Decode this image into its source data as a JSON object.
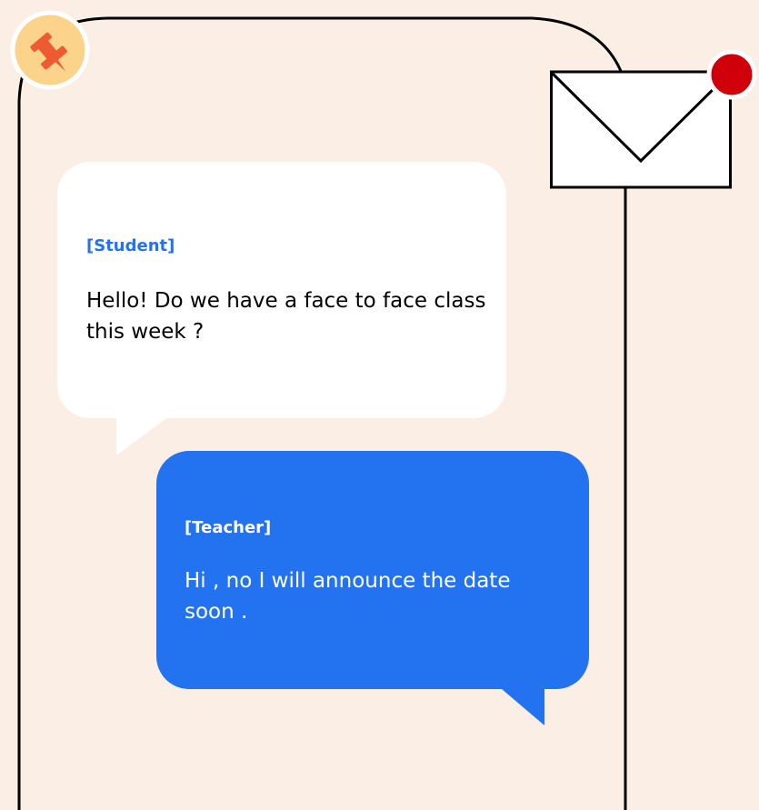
{
  "conversation": {
    "messages": [
      {
        "sender": "[Student]",
        "text": "Hello! Do we have a face to face class this week ?"
      },
      {
        "sender": "[Teacher]",
        "text": "Hi , no I will announce the date soon ."
      }
    ]
  },
  "colors": {
    "background": "#fbeee4",
    "student_bubble": "#ffffff",
    "student_sender": "#2372f0",
    "teacher_bubble": "#2372f0",
    "teacher_text": "#ffffff",
    "notification_dot": "#d0000b",
    "pin_badge": "#fcd38a",
    "pin_icon": "#ee5b32"
  },
  "icons": {
    "badge": "pushpin-icon",
    "mail": "envelope-icon",
    "unread": "notification-dot"
  }
}
